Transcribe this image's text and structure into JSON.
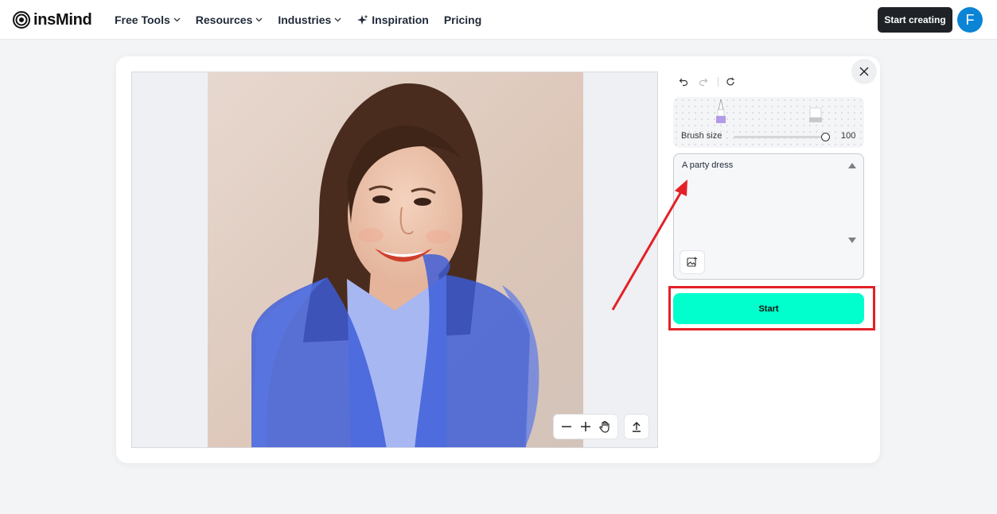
{
  "app": {
    "brand": "insMind"
  },
  "nav": {
    "items": [
      {
        "label": "Free Tools",
        "dropdown": true
      },
      {
        "label": "Resources",
        "dropdown": true
      },
      {
        "label": "Industries",
        "dropdown": true
      },
      {
        "label": "Inspiration",
        "dropdown": false,
        "icon": "sparkle-icon"
      },
      {
        "label": "Pricing",
        "dropdown": false
      }
    ],
    "cta_label": "Start creating",
    "avatar_initial": "F"
  },
  "editor": {
    "brush": {
      "label": "Brush size",
      "value": 100,
      "value_text": "100"
    },
    "prompt": {
      "value": "A party dress"
    },
    "start_label": "Start",
    "toolbar_icons": [
      "undo-icon",
      "redo-icon",
      "reset-icon"
    ],
    "zoom_icons": [
      "zoom-out-icon",
      "zoom-in-icon",
      "hand-icon"
    ],
    "mask_color": "#3a5bd9",
    "start_color": "#00ffcc",
    "highlight_color": "#e32127"
  }
}
